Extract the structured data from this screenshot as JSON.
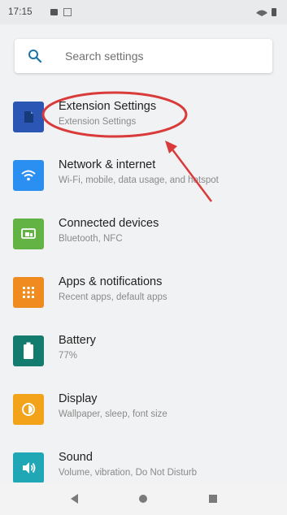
{
  "status_bar": {
    "time": "17:15"
  },
  "search": {
    "placeholder": "Search settings"
  },
  "settings": [
    {
      "title": "Extension Settings",
      "subtitle": "Extension Settings",
      "icon": "extension-icon",
      "color": "#2b56b3"
    },
    {
      "title": "Network & internet",
      "subtitle": "Wi-Fi, mobile, data usage, and hotspot",
      "icon": "wifi-icon",
      "color": "#2a8ff0"
    },
    {
      "title": "Connected devices",
      "subtitle": "Bluetooth, NFC",
      "icon": "connected-devices-icon",
      "color": "#63b344"
    },
    {
      "title": "Apps & notifications",
      "subtitle": "Recent apps, default apps",
      "icon": "apps-icon",
      "color": "#f08b20"
    },
    {
      "title": "Battery",
      "subtitle": "77%",
      "icon": "battery-icon",
      "color": "#147c6e"
    },
    {
      "title": "Display",
      "subtitle": "Wallpaper, sleep, font size",
      "icon": "display-icon",
      "color": "#f3a31a"
    },
    {
      "title": "Sound",
      "subtitle": "Volume, vibration, Do Not Disturb",
      "icon": "sound-icon",
      "color": "#1fa7b6"
    }
  ],
  "annotation": {
    "highlight": "Extension Settings",
    "color": "#d93a3a"
  },
  "navigation": {
    "back": "back-icon",
    "home": "home-icon",
    "recents": "recents-icon"
  }
}
